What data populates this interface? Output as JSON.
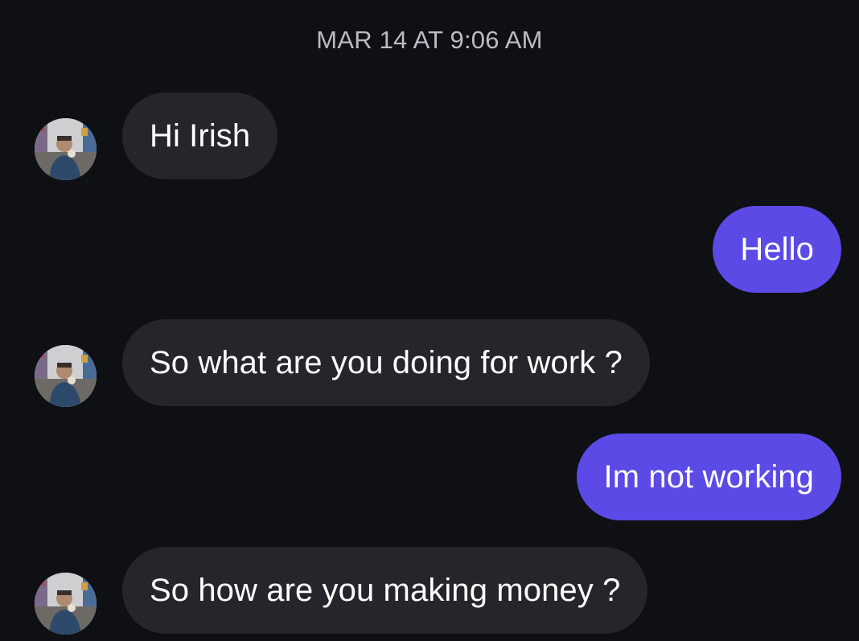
{
  "thread": {
    "timestamp": "MAR 14 AT 9:06 AM"
  },
  "messages": [
    {
      "direction": "incoming",
      "text": "Hi Irish"
    },
    {
      "direction": "outgoing",
      "text": "Hello"
    },
    {
      "direction": "incoming",
      "text": "So what are you doing for work ?"
    },
    {
      "direction": "outgoing",
      "text": "Im not working"
    },
    {
      "direction": "incoming",
      "text": "So how are you making money ?"
    }
  ],
  "colors": {
    "background": "#0f1014",
    "incoming_bubble": "#25262b",
    "outgoing_bubble": "#5b4ae6",
    "timestamp_text": "#b9bcc3"
  }
}
